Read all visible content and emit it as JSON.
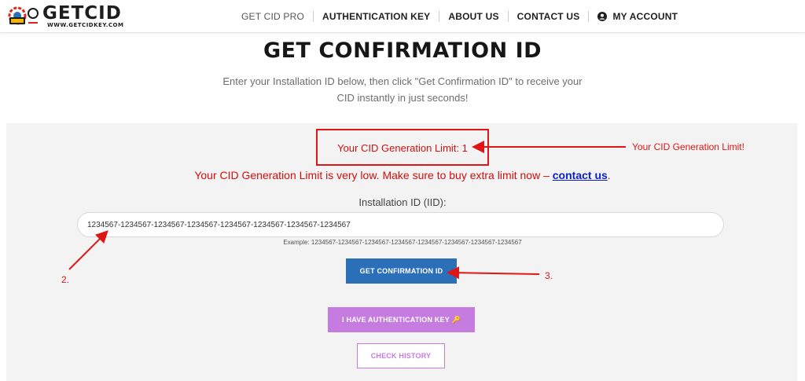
{
  "header": {
    "logo_text": "GETCID",
    "logo_subtext": "WWW.GETCIDKEY.COM",
    "nav": [
      {
        "label": "GET CID PRO"
      },
      {
        "label": "AUTHENTICATION KEY"
      },
      {
        "label": "ABOUT US"
      },
      {
        "label": "CONTACT US"
      },
      {
        "label": "MY ACCOUNT"
      }
    ]
  },
  "main": {
    "title": "GET CONFIRMATION ID",
    "subtitle": "Enter your Installation ID below, then click \"Get Confirmation ID\" to receive your CID instantly in just seconds!",
    "limit_text": "Your CID Generation Limit: 1",
    "warning_text": "Your CID Generation Limit is very low. Make sure to buy extra limit now – ",
    "warning_link": "contact us",
    "warning_end": ".",
    "iid_label": "Installation ID (IID):",
    "iid_value": "1234567-1234567-1234567-1234567-1234567-1234567-1234567-1234567",
    "example": "Example: 1234567-1234567-1234567-1234567-1234567-1234567-1234567-1234567",
    "buttons": {
      "get_cid": "GET CONFIRMATION ID",
      "auth_key": "I HAVE AUTHENTICATION KEY 🔑",
      "history": "CHECK HISTORY"
    }
  },
  "annotations": {
    "limit_note": "Your CID Generation Limit!",
    "step2": "2.",
    "step3": "3."
  },
  "colors": {
    "annotation_red": "#e01515",
    "primary_blue": "#2a6fb8",
    "accent_purple": "#c57be0",
    "link_blue": "#0a1fd0"
  }
}
